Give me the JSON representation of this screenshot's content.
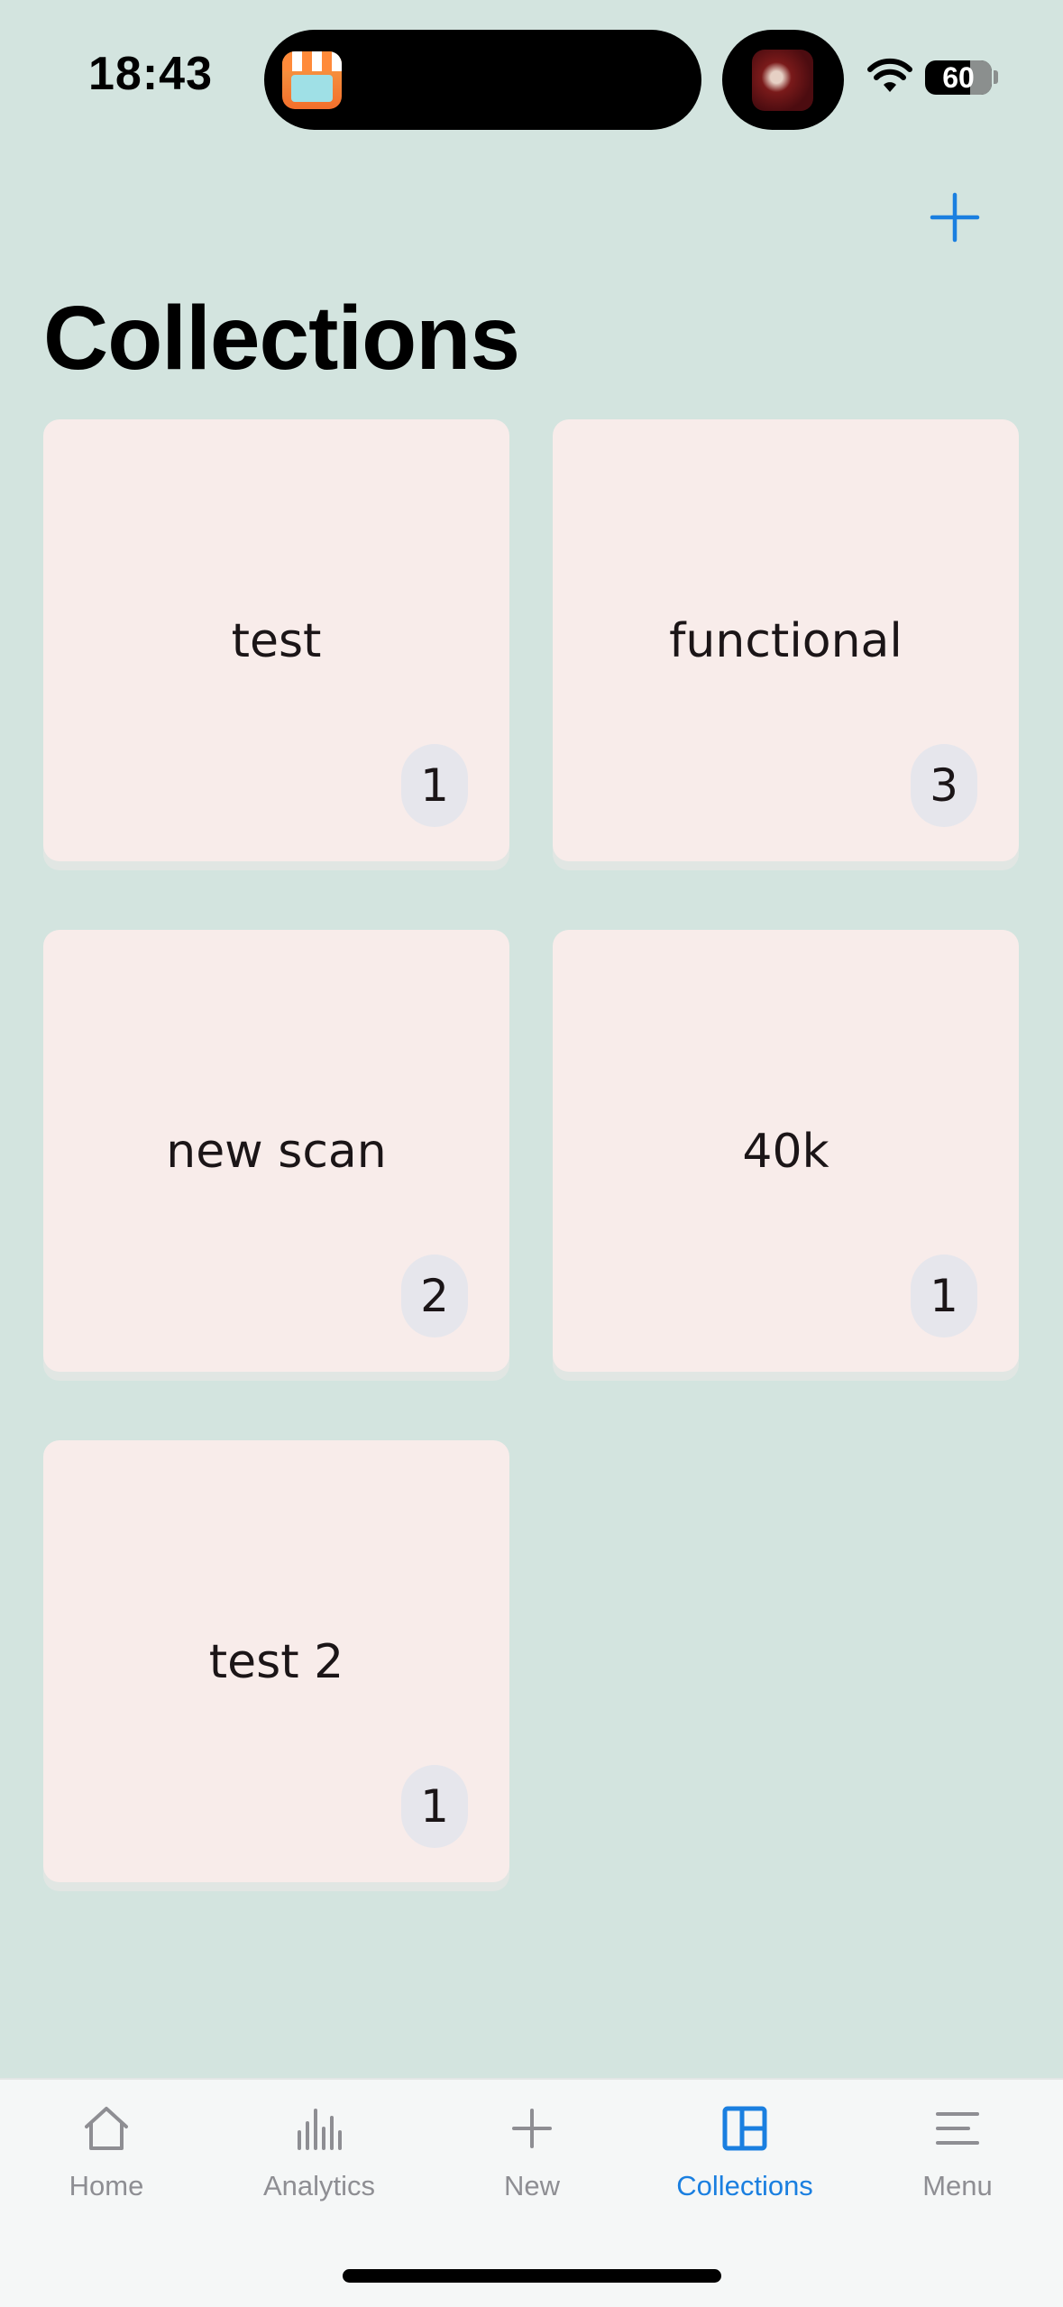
{
  "status_bar": {
    "time": "18:43",
    "battery": "60",
    "icons": [
      "wifi-icon",
      "battery-icon"
    ]
  },
  "header": {
    "title": "Collections",
    "add_icon": "plus-icon"
  },
  "collections": [
    {
      "name": "test",
      "count": "1"
    },
    {
      "name": "functional",
      "count": "3"
    },
    {
      "name": "new scan",
      "count": "2"
    },
    {
      "name": "40k",
      "count": "1"
    },
    {
      "name": "test 2",
      "count": "1"
    }
  ],
  "tabbar": {
    "tabs": [
      {
        "label": "Home",
        "icon": "house-icon"
      },
      {
        "label": "Analytics",
        "icon": "bar-chart-icon"
      },
      {
        "label": "New",
        "icon": "plus-icon"
      },
      {
        "label": "Collections",
        "icon": "collections-grid-icon",
        "active": true
      },
      {
        "label": "Menu",
        "icon": "menu-icon"
      }
    ]
  },
  "colors": {
    "background": "#d3e4df",
    "card": "#f8ecea",
    "accent": "#1a7fe0",
    "tab_inactive": "#8e8e93"
  }
}
